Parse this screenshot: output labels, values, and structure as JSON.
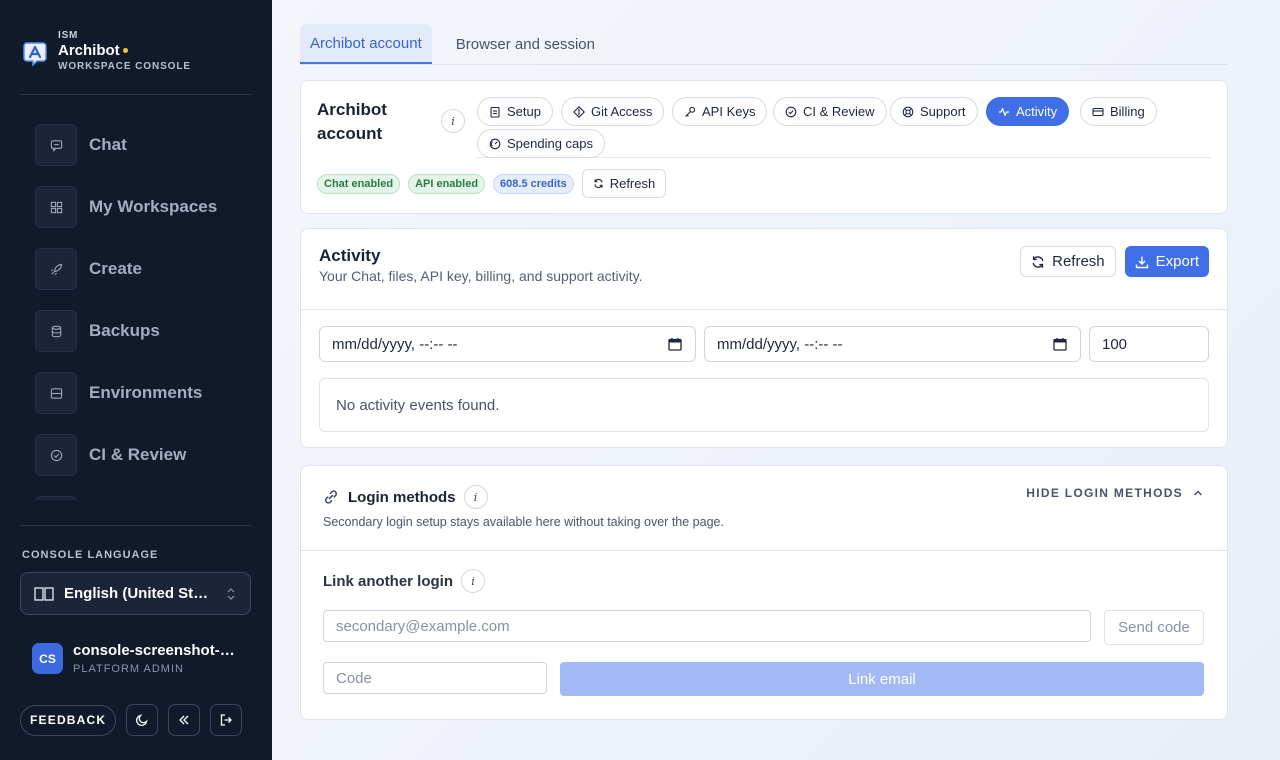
{
  "brand": {
    "org": "ISM",
    "name": "Archibot",
    "subtitle": "WORKSPACE CONSOLE",
    "accent_dot_color": "#f5c63b",
    "logo_icon": "archibot-logo-icon"
  },
  "sidebar": {
    "items": [
      {
        "label": "Chat",
        "icon": "chat-icon"
      },
      {
        "label": "My Workspaces",
        "icon": "grid-icon"
      },
      {
        "label": "Create",
        "icon": "rocket-icon"
      },
      {
        "label": "Backups",
        "icon": "database-icon"
      },
      {
        "label": "Environments",
        "icon": "server-icon"
      },
      {
        "label": "CI & Review",
        "icon": "check-circle-icon"
      }
    ],
    "language_title": "CONSOLE LANGUAGE",
    "language_value": "English (United States)",
    "user_initials": "CS",
    "user_name": "console-screenshot-platform-admin",
    "user_role": "PLATFORM ADMIN",
    "feedback_label": "FEEDBACK",
    "theme_icon": "moon-icon",
    "collapse_icon": "double-chevron-left-icon",
    "logout_icon": "logout-icon"
  },
  "tabs": [
    {
      "label": "Archibot account",
      "active": true
    },
    {
      "label": "Browser and session",
      "active": false
    }
  ],
  "account": {
    "title": "Archibot account",
    "pills": [
      {
        "label": "Setup",
        "icon": "clipboard-icon",
        "active": false
      },
      {
        "label": "Git Access",
        "icon": "git-icon",
        "active": false
      },
      {
        "label": "API Keys",
        "icon": "key-icon",
        "active": false
      },
      {
        "label": "CI & Review",
        "icon": "check-circle-icon",
        "active": false
      },
      {
        "label": "Support",
        "icon": "lifebuoy-icon",
        "active": false
      },
      {
        "label": "Activity",
        "icon": "activity-icon",
        "active": true
      },
      {
        "label": "Billing",
        "icon": "credit-card-icon",
        "active": false
      },
      {
        "label": "Spending caps",
        "icon": "gauge-icon",
        "active": false
      }
    ],
    "badges": {
      "chat": "Chat enabled",
      "api": "API enabled",
      "credits": "608.5 credits"
    },
    "refresh_label": "Refresh"
  },
  "activity": {
    "title": "Activity",
    "subtitle": "Your Chat, files, API key, billing, and support activity.",
    "refresh_label": "Refresh",
    "export_label": "Export",
    "from_placeholder": "mm/dd/yyyy, --:-- --",
    "to_placeholder": "mm/dd/yyyy, --:-- --",
    "limit_value": "100",
    "empty_message": "No activity events found."
  },
  "login_methods": {
    "title": "Login methods",
    "hide_label": "HIDE LOGIN METHODS",
    "subtitle": "Secondary login setup stays available here without taking over the page.",
    "link_title": "Link another login",
    "email_placeholder": "secondary@example.com",
    "send_code_label": "Send code",
    "code_placeholder": "Code",
    "link_email_label": "Link email"
  },
  "colors": {
    "sidebar_bg": "#111a2b",
    "primary": "#3f6ee6",
    "primary_disabled": "#a2b9f3",
    "success_badge": "#e4f5ea",
    "info_badge": "#e6eefc"
  }
}
